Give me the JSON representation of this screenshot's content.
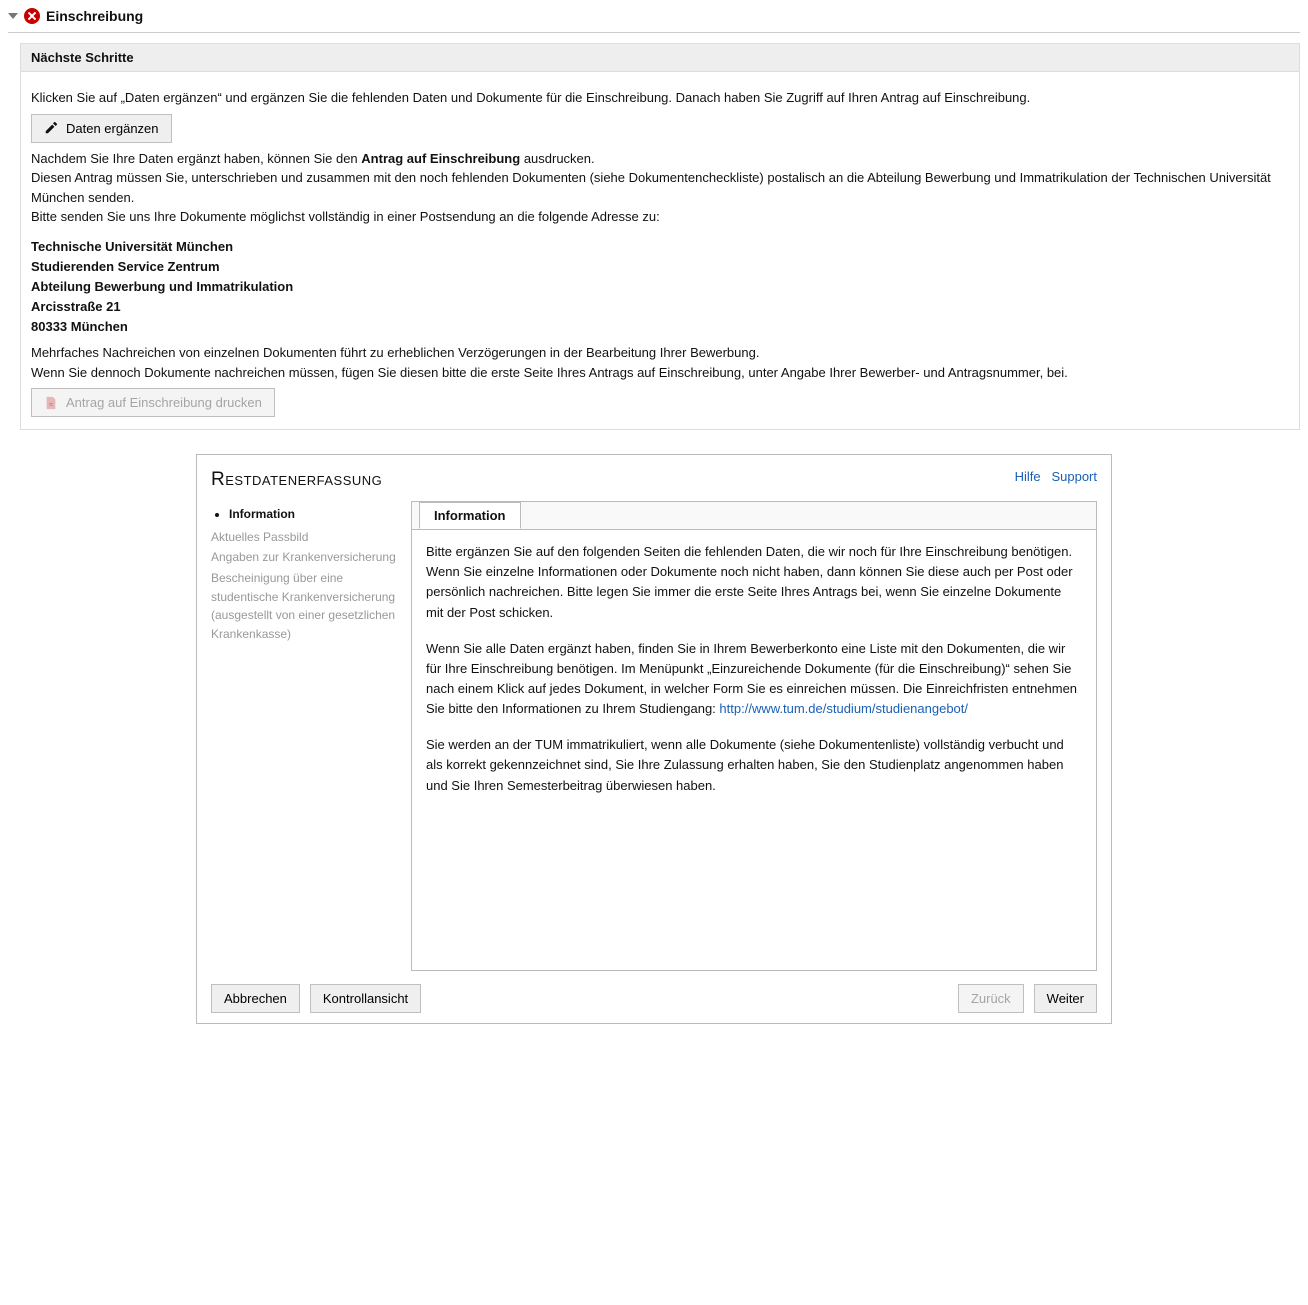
{
  "header": {
    "title": "Einschreibung"
  },
  "next_steps": {
    "heading": "Nächste Schritte",
    "intro": "Klicken Sie auf „Daten ergänzen“ und ergänzen Sie die fehlenden Daten und Dokumente für die Einschreibung. Danach haben Sie Zugriff auf Ihren Antrag auf Einschreibung.",
    "btn_daten": "Daten ergänzen",
    "after1a": "Nachdem Sie Ihre Daten ergänzt haben, können Sie den ",
    "after1b": "Antrag auf Einschreibung",
    "after1c": " ausdrucken.",
    "after2": "Diesen Antrag müssen Sie, unterschrieben und zusammen mit den noch fehlenden Dokumenten (siehe Dokumentencheckliste) postalisch an die Abteilung Bewerbung und Immatrikulation der Technischen Universität München senden.",
    "after3": "Bitte senden Sie uns Ihre Dokumente möglichst vollständig in einer Postsendung an die folgende Adresse zu:",
    "address": {
      "l1": "Technische Universität München",
      "l2": "Studierenden Service Zentrum",
      "l3": "Abteilung Bewerbung und Immatrikulation",
      "l4": "Arcisstraße 21",
      "l5": "80333 München"
    },
    "note1": "Mehrfaches Nachreichen von einzelnen Dokumenten führt zu erheblichen Verzögerungen in der Bearbeitung Ihrer Bewerbung.",
    "note2": "Wenn Sie dennoch Dokumente nachreichen müssen, fügen Sie diesen bitte die erste Seite Ihres Antrags auf Einschreibung, unter Angabe Ihrer Bewerber- und Antragsnummer, bei.",
    "btn_print": "Antrag auf Einschreibung drucken"
  },
  "wizard": {
    "title": "Restdatenerfassung",
    "help": "Hilfe",
    "support": "Support",
    "nav": {
      "i0": "Information",
      "i1": "Aktuelles Passbild",
      "i2": "Angaben zur Krankenversicherung",
      "i3": "Bescheinigung über eine studentische Krankenversicherung (ausgestellt von einer gesetzlichen Krankenkasse)"
    },
    "tab": "Information",
    "p1": "Bitte ergänzen Sie auf den folgenden Seiten die fehlenden Daten, die wir noch für Ihre Einschreibung benötigen. Wenn Sie einzelne Informationen oder Dokumente noch nicht haben, dann können Sie diese auch per Post oder persönlich nachreichen. Bitte legen Sie immer die erste Seite Ihres Antrags bei, wenn Sie einzelne Dokumente mit der Post schicken.",
    "p2a": "Wenn Sie alle Daten ergänzt haben, finden Sie in Ihrem Bewerberkonto eine Liste mit den Dokumenten, die wir für Ihre Einschreibung benötigen. Im Menüpunkt „Einzureichende Dokumente (für die Einschreibung)“ sehen Sie nach einem Klick auf jedes Dokument, in welcher Form Sie es einreichen müssen. Die Einreichfristen entnehmen Sie bitte den Informationen zu Ihrem Studiengang: ",
    "p2link": "http://www.tum.de/studium/studienangebot/",
    "p3": "Sie werden an der TUM immatrikuliert, wenn alle Dokumente (siehe Dokumentenliste) vollständig verbucht und als korrekt gekennzeichnet sind, Sie Ihre Zulassung erhalten haben, Sie den Studienplatz angenommen haben und Sie Ihren Semesterbeitrag überwiesen haben.",
    "btn_cancel": "Abbrechen",
    "btn_preview": "Kontrollansicht",
    "btn_back": "Zurück",
    "btn_next": "Weiter"
  }
}
